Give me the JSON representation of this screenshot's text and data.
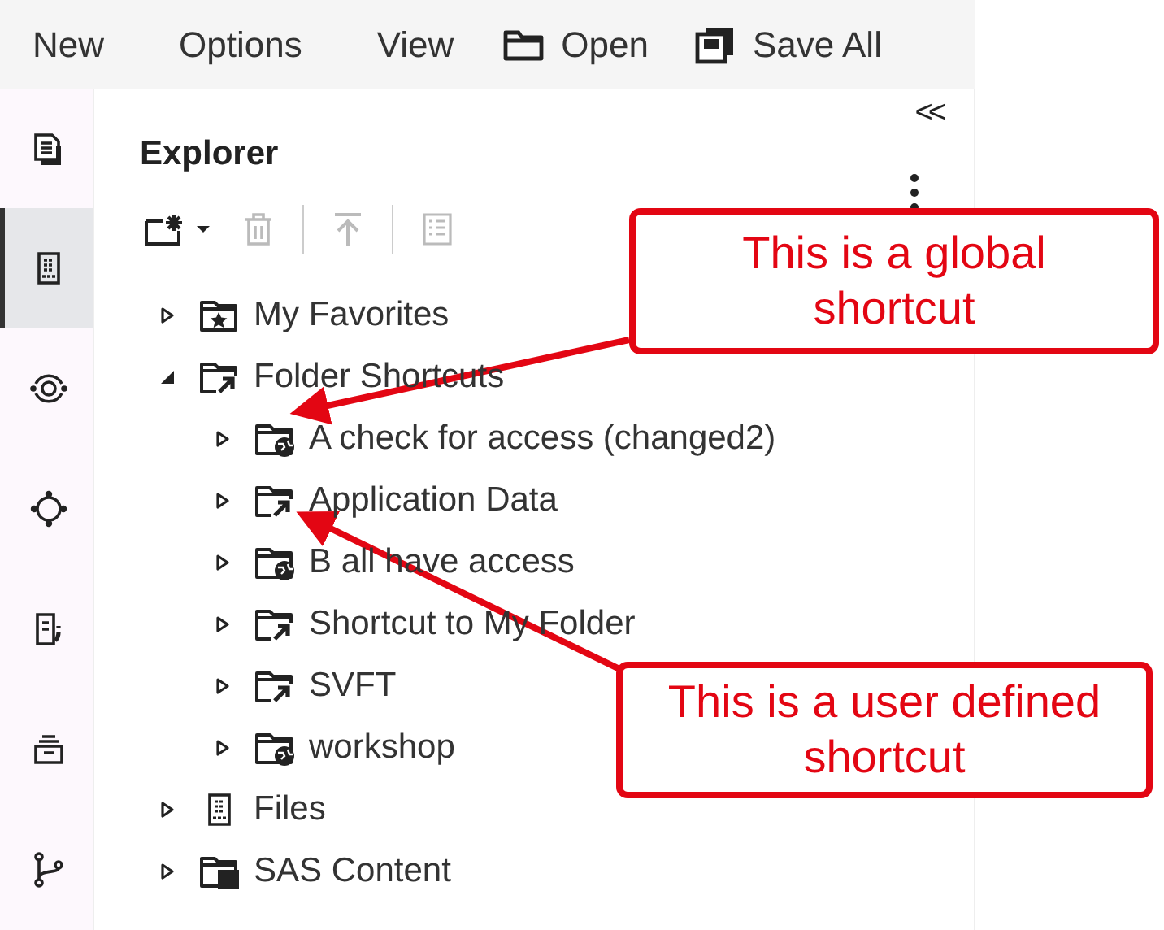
{
  "menubar": [
    {
      "kind": "text",
      "label": "New"
    },
    {
      "kind": "text",
      "label": "Options"
    },
    {
      "kind": "text",
      "label": "View"
    },
    {
      "kind": "folder",
      "label": "Open"
    },
    {
      "kind": "save",
      "label": "Save All"
    }
  ],
  "sidebar": [
    {
      "kind": "documents",
      "selected": false
    },
    {
      "kind": "files",
      "selected": true
    },
    {
      "kind": "eye",
      "selected": false
    },
    {
      "kind": "target",
      "selected": false
    },
    {
      "kind": "code",
      "selected": false
    },
    {
      "kind": "stack",
      "selected": false
    },
    {
      "kind": "branch",
      "selected": false
    }
  ],
  "explorer": {
    "collapse_label": "<<",
    "title": "Explorer",
    "toolbar": [
      {
        "kind": "new",
        "disabled": false
      },
      {
        "kind": "delete",
        "disabled": true
      },
      {
        "kind": "upload",
        "disabled": true
      },
      {
        "kind": "properties",
        "disabled": true
      }
    ],
    "tree": [
      {
        "label": "My Favorites",
        "kind": "favorites",
        "expanded": false
      },
      {
        "label": "Folder Shortcuts",
        "kind": "shortcut",
        "expanded": true,
        "children": [
          {
            "label": "A check for access (changed2)",
            "kind": "global",
            "expanded": false
          },
          {
            "label": "Application Data",
            "kind": "shortcut",
            "expanded": false
          },
          {
            "label": "B all have access",
            "kind": "global",
            "expanded": false
          },
          {
            "label": "Shortcut to My Folder",
            "kind": "shortcut",
            "expanded": false
          },
          {
            "label": "SVFT",
            "kind": "shortcut",
            "expanded": false
          },
          {
            "label": "workshop",
            "kind": "global",
            "expanded": false
          }
        ]
      },
      {
        "label": "Files",
        "kind": "files",
        "expanded": false
      },
      {
        "label": "SAS Content",
        "kind": "content",
        "expanded": false
      }
    ]
  },
  "callouts": [
    {
      "lines": [
        "This is a global",
        "shortcut"
      ]
    },
    {
      "lines": [
        "This is a user defined",
        "shortcut"
      ]
    }
  ]
}
